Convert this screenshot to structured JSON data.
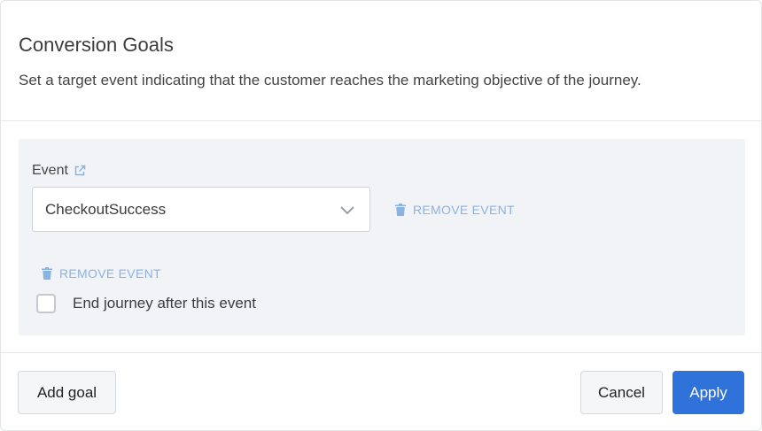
{
  "dialog": {
    "title": "Conversion Goals",
    "subtitle": "Set a target event indicating that the customer reaches the marketing objective of the journey."
  },
  "goal": {
    "event_label": "Event",
    "selected_event": "CheckoutSuccess",
    "remove_event_label": "REMOVE EVENT",
    "remove_event_label_2": "REMOVE EVENT",
    "end_journey_label": "End journey after this event",
    "end_journey_checked": false
  },
  "footer": {
    "add_goal_label": "Add goal",
    "cancel_label": "Cancel",
    "apply_label": "Apply"
  },
  "colors": {
    "primary": "#2f72d9",
    "link": "#8ab3e0",
    "panel_bg": "#f2f3f7"
  },
  "icons": {
    "external": "external-link-icon",
    "dropdown": "chevron-down-icon",
    "remove": "trash-icon"
  }
}
